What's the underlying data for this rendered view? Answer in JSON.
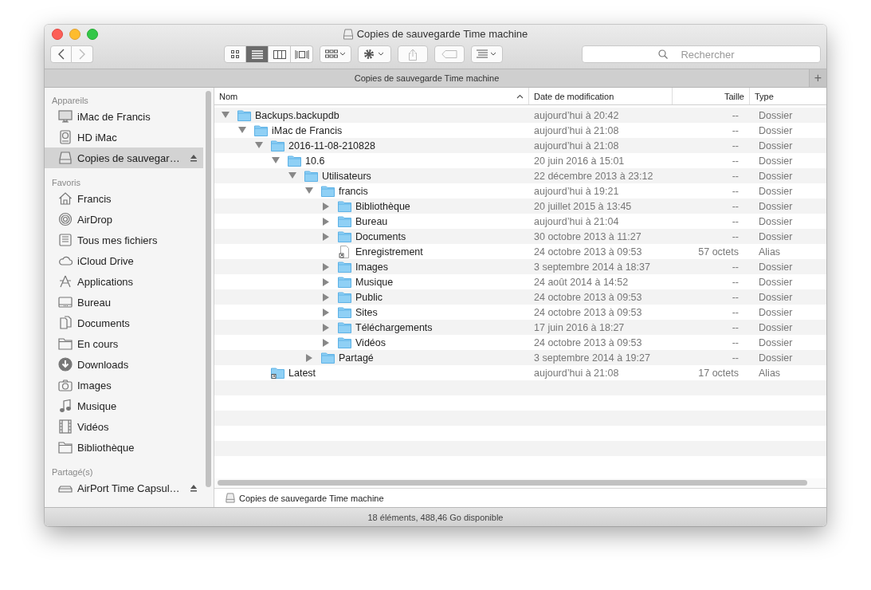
{
  "window": {
    "title": "Copies de sauvegarde Time machine"
  },
  "toolbar": {
    "nav": [
      {
        "kind": "back",
        "disabled": false
      },
      {
        "kind": "forward",
        "disabled": true
      }
    ],
    "views": [
      {
        "kind": "icons",
        "selected": false
      },
      {
        "kind": "list",
        "selected": true
      },
      {
        "kind": "columns",
        "selected": false
      },
      {
        "kind": "coverflow",
        "selected": false
      }
    ],
    "actions": [
      {
        "kind": "arrange",
        "disabled": false
      },
      {
        "kind": "action",
        "disabled": false
      },
      {
        "kind": "share",
        "disabled": true
      },
      {
        "kind": "tags",
        "disabled": true
      },
      {
        "kind": "group",
        "disabled": false
      }
    ],
    "search": {
      "placeholder": "Rechercher"
    }
  },
  "tab": {
    "label": "Copies de sauvegarde Time machine",
    "add": "+"
  },
  "sidebar": {
    "sections": [
      {
        "title": "Appareils",
        "items": [
          {
            "label": "iMac de Francis",
            "kind": "computer",
            "selected": false,
            "ejectable": false
          },
          {
            "label": "HD iMac",
            "kind": "disk",
            "selected": false,
            "ejectable": false
          },
          {
            "label": "Copies de sauvegar…",
            "kind": "drive",
            "selected": true,
            "ejectable": true
          }
        ]
      },
      {
        "title": "Favoris",
        "items": [
          {
            "label": "Francis",
            "kind": "home",
            "selected": false,
            "ejectable": false
          },
          {
            "label": "AirDrop",
            "kind": "airdrop",
            "selected": false,
            "ejectable": false
          },
          {
            "label": "Tous mes fichiers",
            "kind": "files",
            "selected": false,
            "ejectable": false
          },
          {
            "label": "iCloud Drive",
            "kind": "cloud",
            "selected": false,
            "ejectable": false
          },
          {
            "label": "Applications",
            "kind": "apps",
            "selected": false,
            "ejectable": false
          },
          {
            "label": "Bureau",
            "kind": "desktop",
            "selected": false,
            "ejectable": false
          },
          {
            "label": "Documents",
            "kind": "documents",
            "selected": false,
            "ejectable": false
          },
          {
            "label": "En cours",
            "kind": "folder",
            "selected": false,
            "ejectable": false
          },
          {
            "label": "Downloads",
            "kind": "download",
            "selected": false,
            "ejectable": false
          },
          {
            "label": "Images",
            "kind": "camera",
            "selected": false,
            "ejectable": false
          },
          {
            "label": "Musique",
            "kind": "music",
            "selected": false,
            "ejectable": false
          },
          {
            "label": "Vidéos",
            "kind": "film",
            "selected": false,
            "ejectable": false
          },
          {
            "label": "Bibliothèque",
            "kind": "folder",
            "selected": false,
            "ejectable": false
          }
        ]
      },
      {
        "title": "Partagé(s)",
        "items": [
          {
            "label": "AirPort Time Capsul…",
            "kind": "server",
            "selected": false,
            "ejectable": true
          }
        ]
      }
    ]
  },
  "table": {
    "columns": [
      {
        "label": "Nom",
        "sorted": true
      },
      {
        "label": "Date de modification",
        "sorted": false
      },
      {
        "label": "Taille",
        "sorted": false
      },
      {
        "label": "Type",
        "sorted": false
      }
    ],
    "tree": [
      {
        "name": "Backups.backupdb",
        "kind": "folder",
        "date": "aujourd’hui à 20:42",
        "size": "--",
        "type": "Dossier",
        "expanded": true,
        "children": [
          {
            "name": "iMac de Francis",
            "kind": "folder",
            "date": "aujourd’hui à 21:08",
            "size": "--",
            "type": "Dossier",
            "expanded": true,
            "children": [
              {
                "name": "2016-11-08-210828",
                "kind": "folder",
                "date": "aujourd’hui à 21:08",
                "size": "--",
                "type": "Dossier",
                "expanded": true,
                "children": [
                  {
                    "name": "10.6",
                    "kind": "folder",
                    "date": "20 juin 2016 à 15:01",
                    "size": "--",
                    "type": "Dossier",
                    "expanded": true,
                    "children": [
                      {
                        "name": "Utilisateurs",
                        "kind": "folder",
                        "date": "22 décembre 2013 à 23:12",
                        "size": "--",
                        "type": "Dossier",
                        "expanded": true,
                        "children": [
                          {
                            "name": "francis",
                            "kind": "folder",
                            "date": "aujourd’hui à 19:21",
                            "size": "--",
                            "type": "Dossier",
                            "expanded": true,
                            "children": [
                              {
                                "name": "Bibliothèque",
                                "kind": "folder",
                                "date": "20 juillet 2015 à 13:45",
                                "size": "--",
                                "type": "Dossier",
                                "expanded": false
                              },
                              {
                                "name": "Bureau",
                                "kind": "folder",
                                "date": "aujourd’hui à 21:04",
                                "size": "--",
                                "type": "Dossier",
                                "expanded": false
                              },
                              {
                                "name": "Documents",
                                "kind": "folder",
                                "date": "30 octobre 2013 à 11:27",
                                "size": "--",
                                "type": "Dossier",
                                "expanded": false
                              },
                              {
                                "name": "Enregistrement",
                                "kind": "alias-file",
                                "date": "24 octobre 2013 à 09:53",
                                "size": "57 octets",
                                "type": "Alias"
                              },
                              {
                                "name": "Images",
                                "kind": "folder",
                                "date": "3 septembre 2014 à 18:37",
                                "size": "--",
                                "type": "Dossier",
                                "expanded": false
                              },
                              {
                                "name": "Musique",
                                "kind": "folder",
                                "date": "24 août 2014 à 14:52",
                                "size": "--",
                                "type": "Dossier",
                                "expanded": false
                              },
                              {
                                "name": "Public",
                                "kind": "folder",
                                "date": "24 octobre 2013 à 09:53",
                                "size": "--",
                                "type": "Dossier",
                                "expanded": false
                              },
                              {
                                "name": "Sites",
                                "kind": "folder",
                                "date": "24 octobre 2013 à 09:53",
                                "size": "--",
                                "type": "Dossier",
                                "expanded": false
                              },
                              {
                                "name": "Téléchargements",
                                "kind": "folder",
                                "date": "17 juin 2016 à 18:27",
                                "size": "--",
                                "type": "Dossier",
                                "expanded": false
                              },
                              {
                                "name": "Vidéos",
                                "kind": "folder",
                                "date": "24 octobre 2013 à 09:53",
                                "size": "--",
                                "type": "Dossier",
                                "expanded": false
                              }
                            ]
                          },
                          {
                            "name": "Partagé",
                            "kind": "folder",
                            "date": "3 septembre 2014 à 19:27",
                            "size": "--",
                            "type": "Dossier",
                            "expanded": false
                          }
                        ]
                      }
                    ]
                  }
                ]
              },
              {
                "name": "Latest",
                "kind": "alias-folder",
                "date": "aujourd’hui à 21:08",
                "size": "17 octets",
                "type": "Alias"
              }
            ]
          }
        ]
      }
    ]
  },
  "path_bar": {
    "label": "Copies de sauvegarde Time machine"
  },
  "status_bar": "18 éléments, 488,46 Go disponible"
}
